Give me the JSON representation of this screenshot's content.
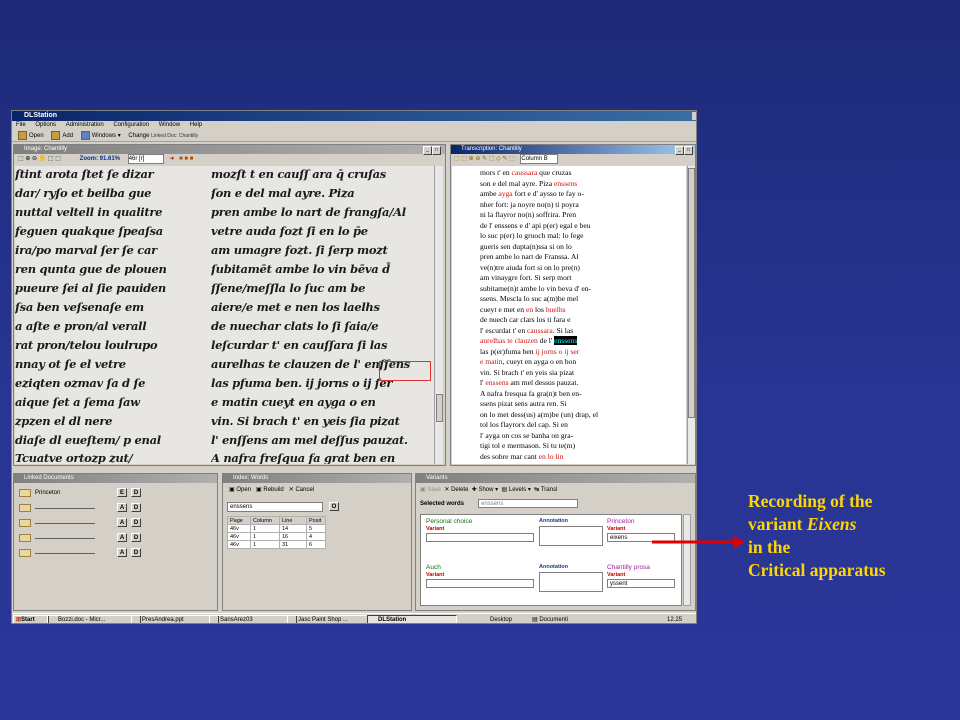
{
  "app": {
    "title": "DLStation",
    "menu": [
      "File",
      "Options",
      "Administration",
      "Configuration",
      "Window",
      "Help"
    ],
    "toolbar": {
      "open": "Open",
      "add": "Add",
      "windows": "Windows",
      "change": "Change",
      "linked_doc": "Linked Doc: Chantilly"
    }
  },
  "image_pane": {
    "title": "Image: Chantilly",
    "zoom": "Zoom: 91.61%",
    "page_select": "46r [r]",
    "left_column": [
      "ſtint arota ſtet ſe dizar",
      "dar/ ryſo et beilba gue",
      "nuttal veltell in qualitre",
      "feguen quakque ſpeaſsa",
      "ira/po marval ſer ſe car",
      "ren qunta gue de plouen",
      "pueure ſei al ſie pauiden",
      "ſsa ben veſsenaſe em",
      "a aſte e pron/al verall",
      "rat pron/telou loulrupo",
      "nnay ot ſe  el vetre",
      "eziqten ozmav ſa d ſe",
      "aique ſet a ſema ſaw",
      "zpzen el dl nere",
      "diaſe dl eueſtem/ p enal",
      "Tcuatve ortozp zut/"
    ],
    "right_column": [
      "mozſt t en cauſſ ara q̄ cruſas",
      "ſon e del mal ayre. Piza",
      "pren ambe lo nart de frangſa/Al",
      "vetre auda fozt ſi en lo p̄e",
      "am umagre fozt. ſi ſerp mozt",
      "ſubitamēt ambe lo vin bēva d̄",
      "ſſene/meſſla lo ſuc am be",
      "aiere/e met e nen los laelhs",
      "de nuechar clats lo ſi ſaia/e",
      "leſcurdar t' en cauſſara ſi las",
      "aurelhas te clauzen de l' enſſens",
      "las pfuma ben. ij jorns o ij ſer",
      "e matin cueyt en ayga o en",
      "vin. Si brach t' en yeis ſia pizat",
      "l' enſſens am mel deſſus pauzat.",
      "A nafra freſqua fa grat ben en"
    ]
  },
  "transcription_pane": {
    "title": "Transcription: Chantilly",
    "column": "Column B",
    "lines": [
      [
        {
          "t": "mors t' en "
        },
        {
          "t": "caussara",
          "c": "red"
        },
        {
          "t": " que cruzas"
        }
      ],
      [
        {
          "t": "son e del mal ayre. Piza "
        },
        {
          "t": "enssens",
          "c": "red"
        }
      ],
      [
        {
          "t": "ambe "
        },
        {
          "t": "ayga",
          "c": "red"
        },
        {
          "t": " fort e d' aysso te fay o-"
        }
      ],
      [
        {
          "t": "nher fort: ja noyre no(n) ti poyra"
        }
      ],
      [
        {
          "t": "ni la flayror no(n) soffrira. Pren"
        }
      ],
      [
        {
          "t": "de l' enssens e d' api p(er) egal e beu"
        }
      ],
      [
        {
          "t": "lo suc p(er) lo gruoch mal: lo fege"
        }
      ],
      [
        {
          "t": "gueris sen dupta(n)ssa si on lo"
        }
      ],
      [
        {
          "t": "pren ambe lo nart de Franssa. Al"
        }
      ],
      [
        {
          "t": "ve(n)tre aiuda fort si on lo pre(n)"
        }
      ],
      [
        {
          "t": "am vinaygre fort. Si serp mort"
        }
      ],
      [
        {
          "t": "subitame(n)t ambe lo vin beva d' en-"
        }
      ],
      [
        {
          "t": "ssens. Mescla lo suc a(m)be mel"
        }
      ],
      [
        {
          "t": "cueyt e met en "
        },
        {
          "t": "en",
          "c": "red"
        },
        {
          "t": " los "
        },
        {
          "t": "huelhs",
          "c": "red"
        }
      ],
      [
        {
          "t": "de nuech car clars los ti fara e"
        }
      ],
      [
        {
          "t": "l' escurdat t' en "
        },
        {
          "t": "caussara",
          "c": "red"
        },
        {
          "t": ". Si las"
        }
      ],
      [
        {
          "t": "aurelhas te clauzen",
          "c": "red"
        },
        {
          "t": " de l' "
        },
        {
          "t": "enssens",
          "c": "hl"
        }
      ],
      [
        {
          "t": "las p(er)fuma ben "
        },
        {
          "t": "ij jorns o ij ser",
          "c": "red"
        }
      ],
      [
        {
          "t": "e matin",
          "c": "red"
        },
        {
          "t": ", cueyt en ayga o en bon"
        }
      ],
      [
        {
          "t": "vin. Si brach t' en yeis sia pizat"
        }
      ],
      [
        {
          "t": "l' "
        },
        {
          "t": "enssens",
          "c": "red"
        },
        {
          "t": " am mel dessus pauzat."
        }
      ],
      [
        {
          "t": "A nafra fresqua fa gra(n)t ben en-"
        }
      ],
      [
        {
          "t": "ssens pizat sens autra ren. Si"
        }
      ],
      [
        {
          "t": "on lo met dess(us) a(m)be (un) drap, el"
        }
      ],
      [
        {
          "t": "tol los flayrorx del cap. Si en"
        }
      ],
      [
        {
          "t": "l' ayga on cos se banha on gra-"
        }
      ],
      [
        {
          "t": "tigi tol e mermason. Si tu te(m)"
        }
      ],
      [
        {
          "t": "des sobre mar cant "
        },
        {
          "t": "en lo lin",
          "c": "red"
        }
      ]
    ]
  },
  "linked_documents": {
    "title": "Linked Documents",
    "rows": [
      {
        "name": "Princeton",
        "b1": "E",
        "b2": "D"
      },
      {
        "name": "",
        "b1": "A",
        "b2": "D"
      },
      {
        "name": "",
        "b1": "A",
        "b2": "D"
      },
      {
        "name": "",
        "b1": "A",
        "b2": "D"
      },
      {
        "name": "",
        "b1": "A",
        "b2": "D"
      }
    ]
  },
  "index_words": {
    "title": "Index: Words",
    "buttons": [
      "Open",
      "Rebuild",
      "Cancel"
    ],
    "search_value": "enssens",
    "go_label": "O",
    "headers": [
      "Page",
      "Column",
      "Line",
      "Posit"
    ],
    "rows": [
      [
        "46v",
        "1",
        "14",
        "5"
      ],
      [
        "46v",
        "1",
        "16",
        "4"
      ],
      [
        "46v",
        "1",
        "31",
        "6"
      ]
    ]
  },
  "variants": {
    "title": "Variants",
    "buttons": [
      "Save",
      "Delete",
      "Show",
      "Levels",
      "Transl"
    ],
    "selected_label": "Selected words",
    "selected_value": "enssens",
    "personal_choice": "Personal choice",
    "auch": "Auch",
    "variant_label": "Variant",
    "annotation_label": "Annotation",
    "princeton": "Princeton",
    "princeton_value": "eixens",
    "chantilly": "Chantilly prosa",
    "chantilly_value": "yssent"
  },
  "taskbar": {
    "start": "Start",
    "tasks": [
      "Bozzi.doc - Micr...",
      "PresAndrea.ppt",
      "SansArez03",
      "Jasc Paint Shop ...",
      "DLStation"
    ],
    "desktop": "Desktop",
    "documents": "Documenti",
    "clock": "12.25"
  },
  "caption": {
    "line1": "Recording of the",
    "line2_prefix": "variant ",
    "line2_em": "Eixens",
    "line3": "in the",
    "line4": "Critical apparatus"
  },
  "colors": {
    "caption": "#ffd700",
    "arrow": "#e00000",
    "background": "#283593"
  }
}
